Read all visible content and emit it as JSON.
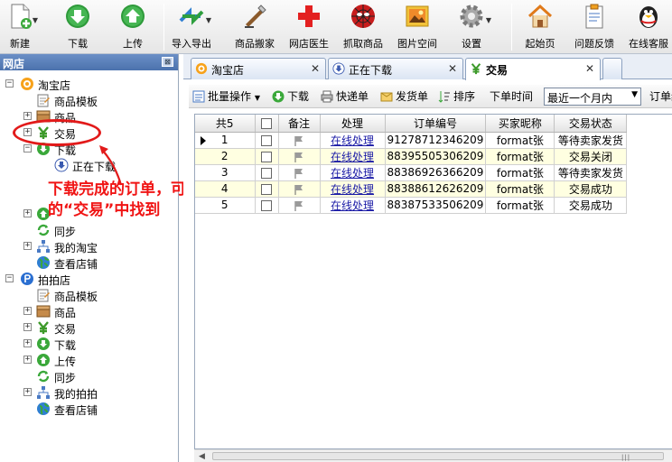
{
  "toolbar": {
    "new": "新建",
    "download": "下载",
    "upload": "上传",
    "import_export": "导入导出",
    "move_goods": "商品搬家",
    "shop_doctor": "网店医生",
    "grab_goods": "抓取商品",
    "image_space": "图片空间",
    "settings": "设置",
    "home": "起始页",
    "feedback": "问题反馈",
    "support": "在线客服"
  },
  "left_panel": {
    "title": "网店",
    "pin": "⊠",
    "tree": {
      "taobao": "淘宝店",
      "taobao_children": [
        "商品模板",
        "商品",
        "交易",
        "下载",
        "正在下载",
        "",
        "",
        "同步",
        "我的淘宝",
        "查看店铺"
      ],
      "paipai": "拍拍店",
      "paipai_children": [
        "商品模板",
        "商品",
        "交易",
        "下载",
        "上传",
        "同步",
        "我的拍拍",
        "查看店铺"
      ]
    }
  },
  "annotation": {
    "text": "下载完成的订单，可在对应网店下的“交易”中找到"
  },
  "tabs": [
    {
      "label": "淘宝店",
      "close": "✕"
    },
    {
      "label": "正在下载",
      "close": "✕"
    },
    {
      "label": "交易",
      "close": "✕"
    }
  ],
  "grid_toolbar": {
    "batch": "批量操作",
    "download": "下载",
    "print": "快递单",
    "ship": "发货单",
    "sort": "排序",
    "time_label": "下单时间",
    "time_value": "最近一个月内",
    "order_label": "订单编"
  },
  "table": {
    "columns": [
      "共5",
      "",
      "备注",
      "处理",
      "订单编号",
      "买家昵称",
      "交易状态"
    ],
    "rows": [
      {
        "no": "1",
        "action": "在线处理",
        "order": "91278712346209",
        "buyer": "format张",
        "status": "等待卖家发货"
      },
      {
        "no": "2",
        "action": "在线处理",
        "order": "88395505306209",
        "buyer": "format张",
        "status": "交易关闭"
      },
      {
        "no": "3",
        "action": "在线处理",
        "order": "88386926366209",
        "buyer": "format张",
        "status": "等待卖家发货"
      },
      {
        "no": "4",
        "action": "在线处理",
        "order": "88388612626209",
        "buyer": "format张",
        "status": "交易成功"
      },
      {
        "no": "5",
        "action": "在线处理",
        "order": "88387533506209",
        "buyer": "format张",
        "status": "交易成功"
      }
    ]
  },
  "colors": {
    "accent_red": "#e21a1a",
    "link": "#1a1aa6",
    "row_highlight": "#ffffe1"
  }
}
